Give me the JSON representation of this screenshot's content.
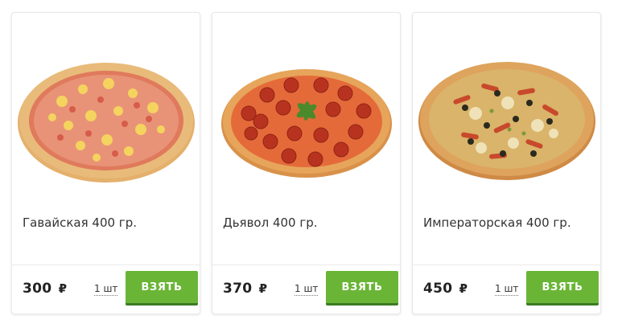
{
  "colors": {
    "accent": "#6ab536",
    "accent_shadow": "#3e7a23",
    "text": "#333333"
  },
  "products": [
    {
      "name": "Гавайская 400 гр.",
      "price": "300",
      "currency": "₽",
      "qty": "1 шт",
      "button": "ВЗЯТЬ",
      "image": "hawaiian-pizza"
    },
    {
      "name": "Дьявол 400 гр.",
      "price": "370",
      "currency": "₽",
      "qty": "1 шт",
      "button": "ВЗЯТЬ",
      "image": "pepperoni-pizza"
    },
    {
      "name": "Императорская 400 гр.",
      "price": "450",
      "currency": "₽",
      "qty": "1 шт",
      "button": "ВЗЯТЬ",
      "image": "imperial-pizza"
    }
  ]
}
